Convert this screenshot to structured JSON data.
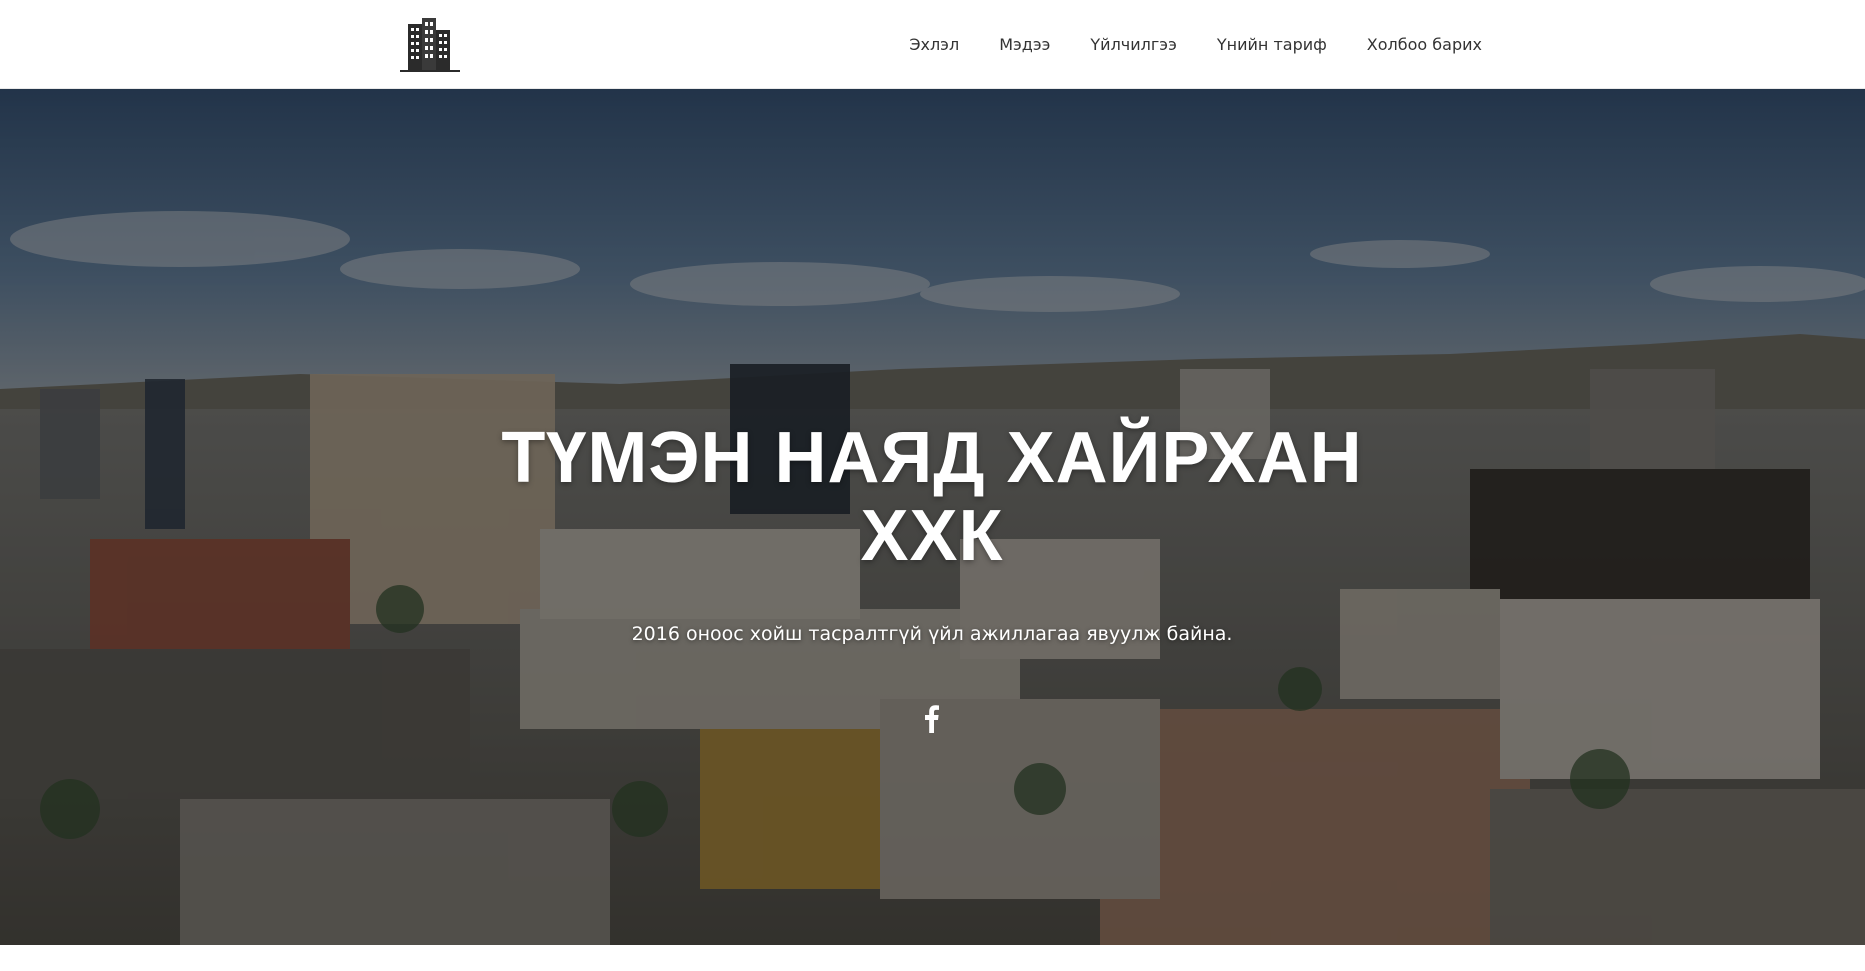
{
  "brand": {
    "logo_icon": "building-icon"
  },
  "nav": {
    "items": [
      {
        "label": "Эхлэл"
      },
      {
        "label": "Мэдээ"
      },
      {
        "label": "Үйлчилгээ"
      },
      {
        "label": "Үнийн тариф"
      },
      {
        "label": "Холбоо барих"
      }
    ]
  },
  "hero": {
    "title_line1": "ТҮМЭН НАЯД ХАЙРХАН",
    "title_line2": "ХХК",
    "subtitle": "2016 оноос хойш тасралтгүй үйл ажиллагаа явуулж байна.",
    "social_icon": "facebook-icon"
  }
}
